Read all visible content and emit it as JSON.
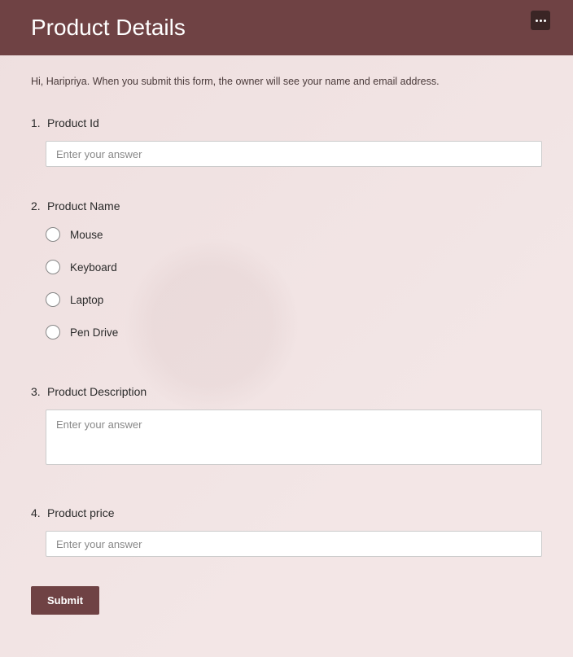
{
  "header": {
    "title": "Product Details"
  },
  "notice": "Hi, Haripriya. When you submit this form, the owner will see your name and email address.",
  "questions": {
    "q1": {
      "num": "1.",
      "label": "Product Id",
      "placeholder": "Enter your answer"
    },
    "q2": {
      "num": "2.",
      "label": "Product Name",
      "options": [
        "Mouse",
        "Keyboard",
        "Laptop",
        "Pen Drive"
      ]
    },
    "q3": {
      "num": "3.",
      "label": "Product Description",
      "placeholder": "Enter your answer"
    },
    "q4": {
      "num": "4.",
      "label": "Product price",
      "placeholder": "Enter your answer"
    }
  },
  "submit_label": "Submit"
}
